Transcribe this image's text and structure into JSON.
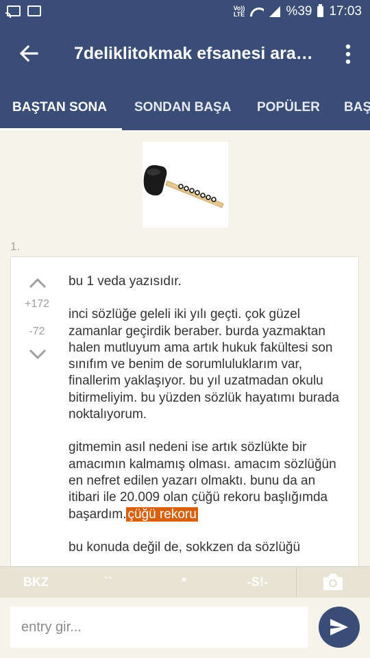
{
  "status_bar": {
    "volte_line1": "Vo))",
    "volte_line2": "LTE",
    "battery": "%39",
    "time": "17:03"
  },
  "app_bar": {
    "title": "7deliklitokmak efsanesi araştırması"
  },
  "tabs": [
    {
      "label": "BAŞTAN SONA"
    },
    {
      "label": "SONDAN BAŞA"
    },
    {
      "label": "POPÜLER"
    },
    {
      "label": "BAŞ"
    }
  ],
  "entry": {
    "number": "1.",
    "upvotes": "+172",
    "downvotes": "-72",
    "paragraphs": [
      "bu 1 veda yazısıdır.",
      "inci sözlüğe geleli iki yılı geçti. çok güzel zamanlar geçirdik beraber. burda yazmaktan halen mutluyum ama artık hukuk fakültesi son sınıfım ve benim de sorumluluklarım var, finallerim yaklaşıyor. bu yıl uzatmadan okulu bitirmeliyim. bu yüzden sözlük hayatımı burada noktalıyorum."
    ],
    "last_paragraph_text": "gitmemin asıl nedeni ise artık sözlükte bir amacımın kalmamış olması. amacım sözlüğün en nefret edilen yazarı olmaktı. bunu da an itibari ile 20.009 olan çüğü rekoru başlığımda başardım.",
    "link_label": "çüğü rekoru",
    "cut_off_line": "bu konuda değil de, sokkzen da sözlüğü"
  },
  "toolbar": {
    "bkz": "BKZ",
    "backticks": "``",
    "asterisk": "*",
    "spoiler": "-S!-"
  },
  "input": {
    "placeholder": "entry gir..."
  },
  "colors": {
    "brand": "#3a4d76",
    "background": "#f5f3ea",
    "link_highlight": "#d9600a"
  }
}
